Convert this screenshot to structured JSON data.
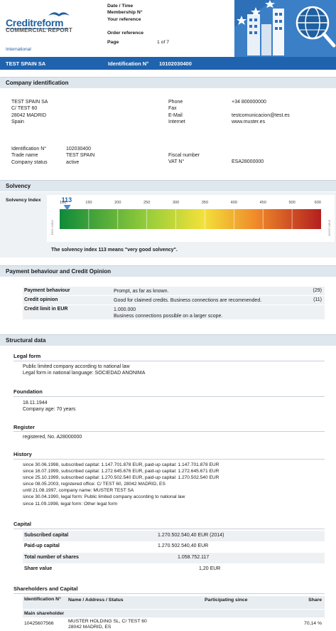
{
  "header": {
    "logo_text": "Creditreform",
    "report_title": "COMMERCIAL REPORT",
    "region": "International",
    "meta_labels": [
      "Date / Time",
      "Membership N°",
      "Your reference",
      "Order reference"
    ],
    "page_label": "Page",
    "page_value": "1 of 7"
  },
  "id_bar": {
    "company": "TEST SPAIN SA",
    "id_label": "Identification N°",
    "id_value": "10102030400"
  },
  "company_identification": {
    "title": "Company identification",
    "address": [
      "TEST SPAIN SA",
      "C/ TEST 60",
      "28042 MADRID",
      "Spain"
    ],
    "contact_labels": [
      "Phone",
      "Fax",
      "E-Mail",
      "Internet"
    ],
    "contact_values": [
      "+34 800000000",
      "",
      "testcomunicacion@test.es",
      "www.muster.es"
    ],
    "details_labels": [
      "Identification N°",
      "Trade name",
      "Company status"
    ],
    "details_values": [
      "102030400",
      "TEST SPAIN",
      "active"
    ],
    "fiscal_label": "Fiscal number",
    "vat_label": "VAT N°",
    "vat_value": "ESA28000000"
  },
  "solvency": {
    "title": "Solvency",
    "label": "Solvency Index",
    "value": 113,
    "value_text": "113",
    "ticks": [
      "100",
      "150",
      "200",
      "250",
      "300",
      "350",
      "400",
      "450",
      "500",
      "600"
    ],
    "left_tag": "best value",
    "right_tag": "worst value",
    "note": "The solvency index 113 means \"very good solvency\"."
  },
  "payment": {
    "title": "Payment behaviour and Credit Opinion",
    "rows": [
      {
        "label": "Payment behaviour",
        "value": "Prompt, as far as known.",
        "code": "(29)"
      },
      {
        "label": "Credit opinion",
        "value": "Good for claimed credits. Business connections are recommended.",
        "code": "(11)"
      },
      {
        "label": "Credit limit in EUR",
        "value": "1.000.000",
        "value2": "Business connections possible on a larger scope.",
        "code": ""
      }
    ]
  },
  "structural": {
    "title": "Structural data",
    "legal_form": {
      "title": "Legal form",
      "lines": [
        "Public limited company according to national law",
        "Legal form in national language: SOCIEDAD ANONIMA"
      ]
    },
    "foundation": {
      "title": "Foundation",
      "lines": [
        "18.11.1944",
        "Company age: 70 years"
      ]
    },
    "register": {
      "title": "Register",
      "lines": [
        "registered, No. A28000000"
      ]
    },
    "history": {
      "title": "History",
      "lines": [
        "since 30.06.1998, subscribed capital: 1.147.701.878 EUR, paid-up capital: 1.147.701.878 EUR",
        "since 16.07.1999, subscribed capital: 1.272.645.676 EUR, paid-up capital: 1.272.645.671 EUR",
        "since 25.10.1999, subscribed capital: 1.270.502.540 EUR, paid-up capital: 1.270.502.540 EUR",
        "since 08.05.2003, registered office: C/ TEST 60, 28042 MADRID, ES",
        "until 21.08.1997, company name: MUSTER TEST SA",
        "since 30.04.1990, legal form: Public limited company according to national law",
        "since 11.09.1998, legal form: Other legal form"
      ]
    },
    "capital": {
      "title": "Capital",
      "rows": [
        {
          "label": "Subscribed capital",
          "value": "1.270.502.540,40 EUR  (2014)"
        },
        {
          "label": "Paid-up capital",
          "value": "1.270.502.540,40 EUR"
        },
        {
          "label": "Total number of shares",
          "value": "1.058.752.117"
        },
        {
          "label": "Share value",
          "value": "1,20 EUR"
        }
      ]
    },
    "shareholders": {
      "title": "Shareholders and Capital",
      "col_id": "Identification N°",
      "col_name": "Name / Address / Status",
      "col_since": "Participating since",
      "col_share": "Share",
      "group": "Main shareholder",
      "row": {
        "id": "10425607566",
        "name": "MUSTER HOLDING SL, C/ TEST 60",
        "addr": "28042 MADRID, ES",
        "share": "70,14 %"
      }
    }
  },
  "colors": {
    "brand": "#1f63ae",
    "section_bg": "#dfe7ee",
    "row_bg": "#eef1f4"
  }
}
